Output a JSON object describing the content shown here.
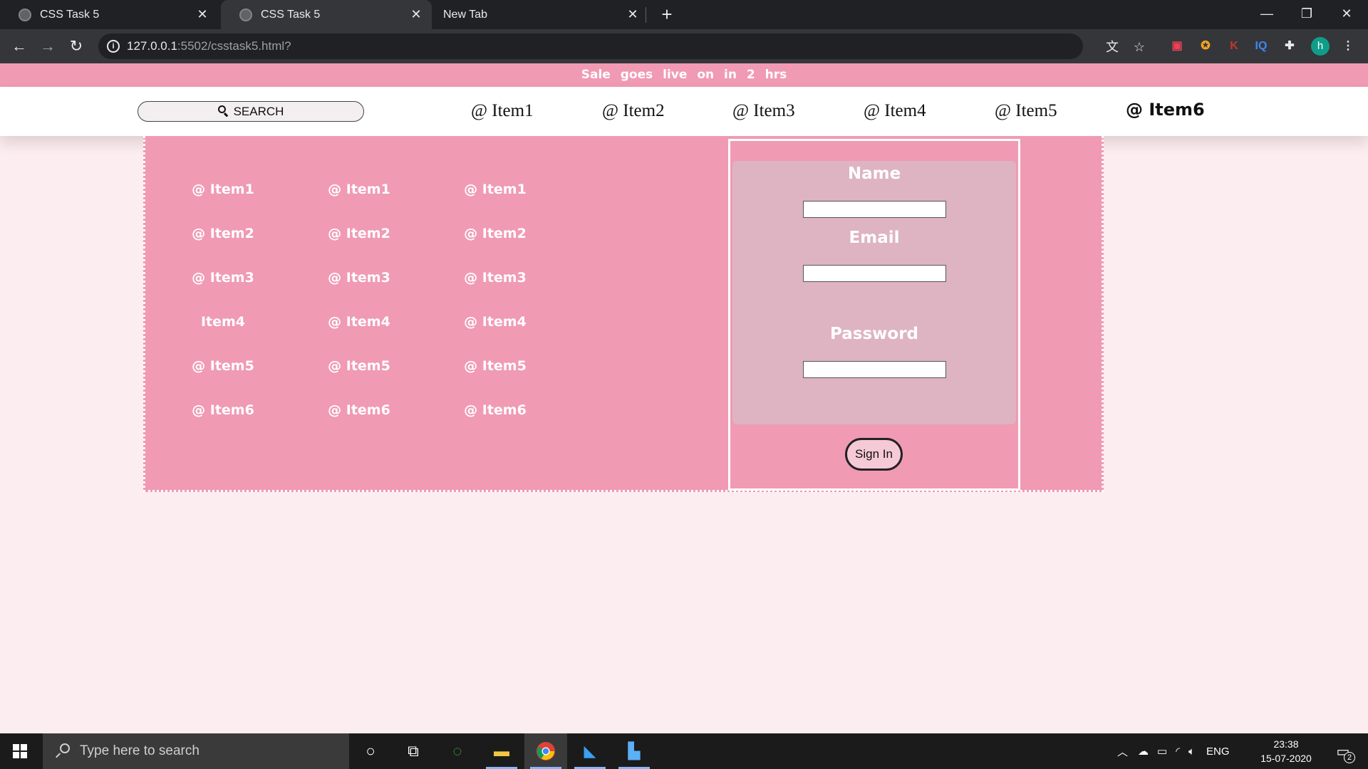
{
  "browser": {
    "tabs": [
      {
        "title": "CSS Task 5",
        "active": false
      },
      {
        "title": "CSS Task 5",
        "active": true
      },
      {
        "title": "New Tab",
        "active": false
      }
    ],
    "url_host": "127.0.0.1",
    "url_rest": ":5502/csstask5.html?",
    "profile_initial": "h",
    "extensions": [
      "translate-icon",
      "star-icon",
      "pocket-icon",
      "extension-icon",
      "k-icon",
      "iq-icon",
      "puzzle-icon"
    ]
  },
  "page": {
    "sale_banner": "Sale goes live on in 2 hrs",
    "search_label": "SEARCH",
    "nav_items": [
      "@ Item1",
      "@ Item2",
      "@ Item3",
      "@ Item4",
      "@ Item5",
      "@ Item6"
    ],
    "menu_columns": [
      [
        "@ Item1",
        "@ Item2",
        "@ Item3",
        "Item4",
        "@ Item5",
        "@ Item6"
      ],
      [
        "@ Item1",
        "@ Item2",
        "@ Item3",
        "@ Item4",
        "@ Item5",
        "@ Item6"
      ],
      [
        "@ Item1",
        "@ Item2",
        "@ Item3",
        "@ Item4",
        "@ Item5",
        "@ Item6"
      ]
    ],
    "form": {
      "name_label": "Name",
      "email_label": "Email",
      "password_label": "Password",
      "signin_label": "Sign In"
    },
    "colors": {
      "accent_pink": "#f09ab4",
      "form_panel": "#deb3c2",
      "page_bg": "#fcedf0"
    }
  },
  "taskbar": {
    "search_placeholder": "Type here to search",
    "language": "ENG",
    "time": "23:38",
    "date": "15-07-2020",
    "notification_count": "2"
  }
}
